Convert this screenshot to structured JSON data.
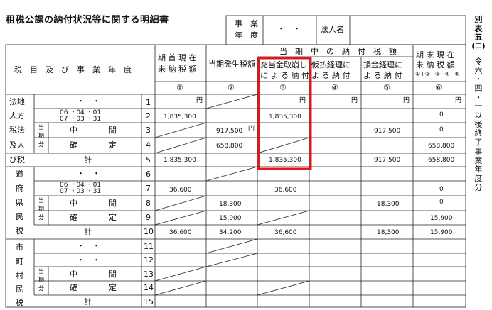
{
  "doc_title": "租税公課の納付状況等に関する明細書",
  "jigyo_nendo_label_1": "事　業",
  "jigyo_nendo_label_2": "年　度",
  "date_dots": "・　・",
  "corp_label": "法人名",
  "form_id_chars": [
    "別",
    "表",
    "五",
    "(二)",
    "",
    "令",
    "六",
    "・",
    "四",
    "・",
    "一",
    "以",
    "後",
    "終",
    "了",
    "事",
    "業",
    "年",
    "度",
    "分"
  ],
  "headers": {
    "rowlabel": "税　目　及　び　事　業　年　度",
    "col1_l1": "期 首 現 在",
    "col1_l2": "未 納 税 額",
    "col2": "当期発生税額",
    "group": "当　期　中　の　納　付　税　額",
    "col3_l1": "充当金取崩し",
    "col3_l2": "に よ る 納 付",
    "col4_l1": "仮払経理に",
    "col4_l2": "よ る 納 付",
    "col5_l1": "損金経理に",
    "col5_l2": "よ る 納 付",
    "col6_l1": "期 末 現 在",
    "col6_l2": "未 納 税 額",
    "col6_l3": "①+②−③−④−⑤",
    "n1": "①",
    "n2": "②",
    "n3": "③",
    "n4": "④",
    "n5": "⑤",
    "n6": "⑥"
  },
  "yen": "円",
  "groups": {
    "hojin": [
      "法地",
      "人方",
      "税法",
      "及人",
      "び税"
    ],
    "fuken": [
      "道",
      "府",
      "県",
      "民",
      "税"
    ],
    "shichoson": [
      "市",
      "町",
      "村",
      "民",
      "税"
    ]
  },
  "period": {
    "p1_l1": "06 ・04 ・01",
    "p1_l2": "07 ・03 ・31",
    "p2_l1": "06 ・04 ・01",
    "p2_l2": "07 ・03 ・31",
    "toki_1": "当",
    "toki_2": "期",
    "toki_3": "分",
    "chukan": "中　　　　間",
    "kakutei": "確　　　　定",
    "kei": "計"
  },
  "line_numbers": [
    "1",
    "2",
    "3",
    "4",
    "5",
    "6",
    "7",
    "8",
    "9",
    "10",
    "11",
    "12",
    "13",
    "14",
    "15"
  ],
  "values": {
    "r2_c1": "1,835,300",
    "r2_c3": "1,835,300",
    "r2_c6": "0",
    "r3_c2": "917,500",
    "r3_c5": "917,500",
    "r3_c6": "0",
    "r4_c2": "658,800",
    "r4_c6": "658,800",
    "r5_c1": "1,835,300",
    "r5_c3": "1,835,300",
    "r5_c5": "917,500",
    "r5_c6": "658,800",
    "r7_c1": "36,600",
    "r7_c3": "36,600",
    "r7_c6": "0",
    "r8_c2": "18,300",
    "r8_c5": "18,300",
    "r8_c6": "0",
    "r9_c2": "15,900",
    "r9_c6": "15,900",
    "r10_c1": "36,600",
    "r10_c2": "34,200",
    "r10_c3": "36,600",
    "r10_c5": "18,300",
    "r10_c6": "15,900"
  },
  "highlight_color": "#e8141b"
}
